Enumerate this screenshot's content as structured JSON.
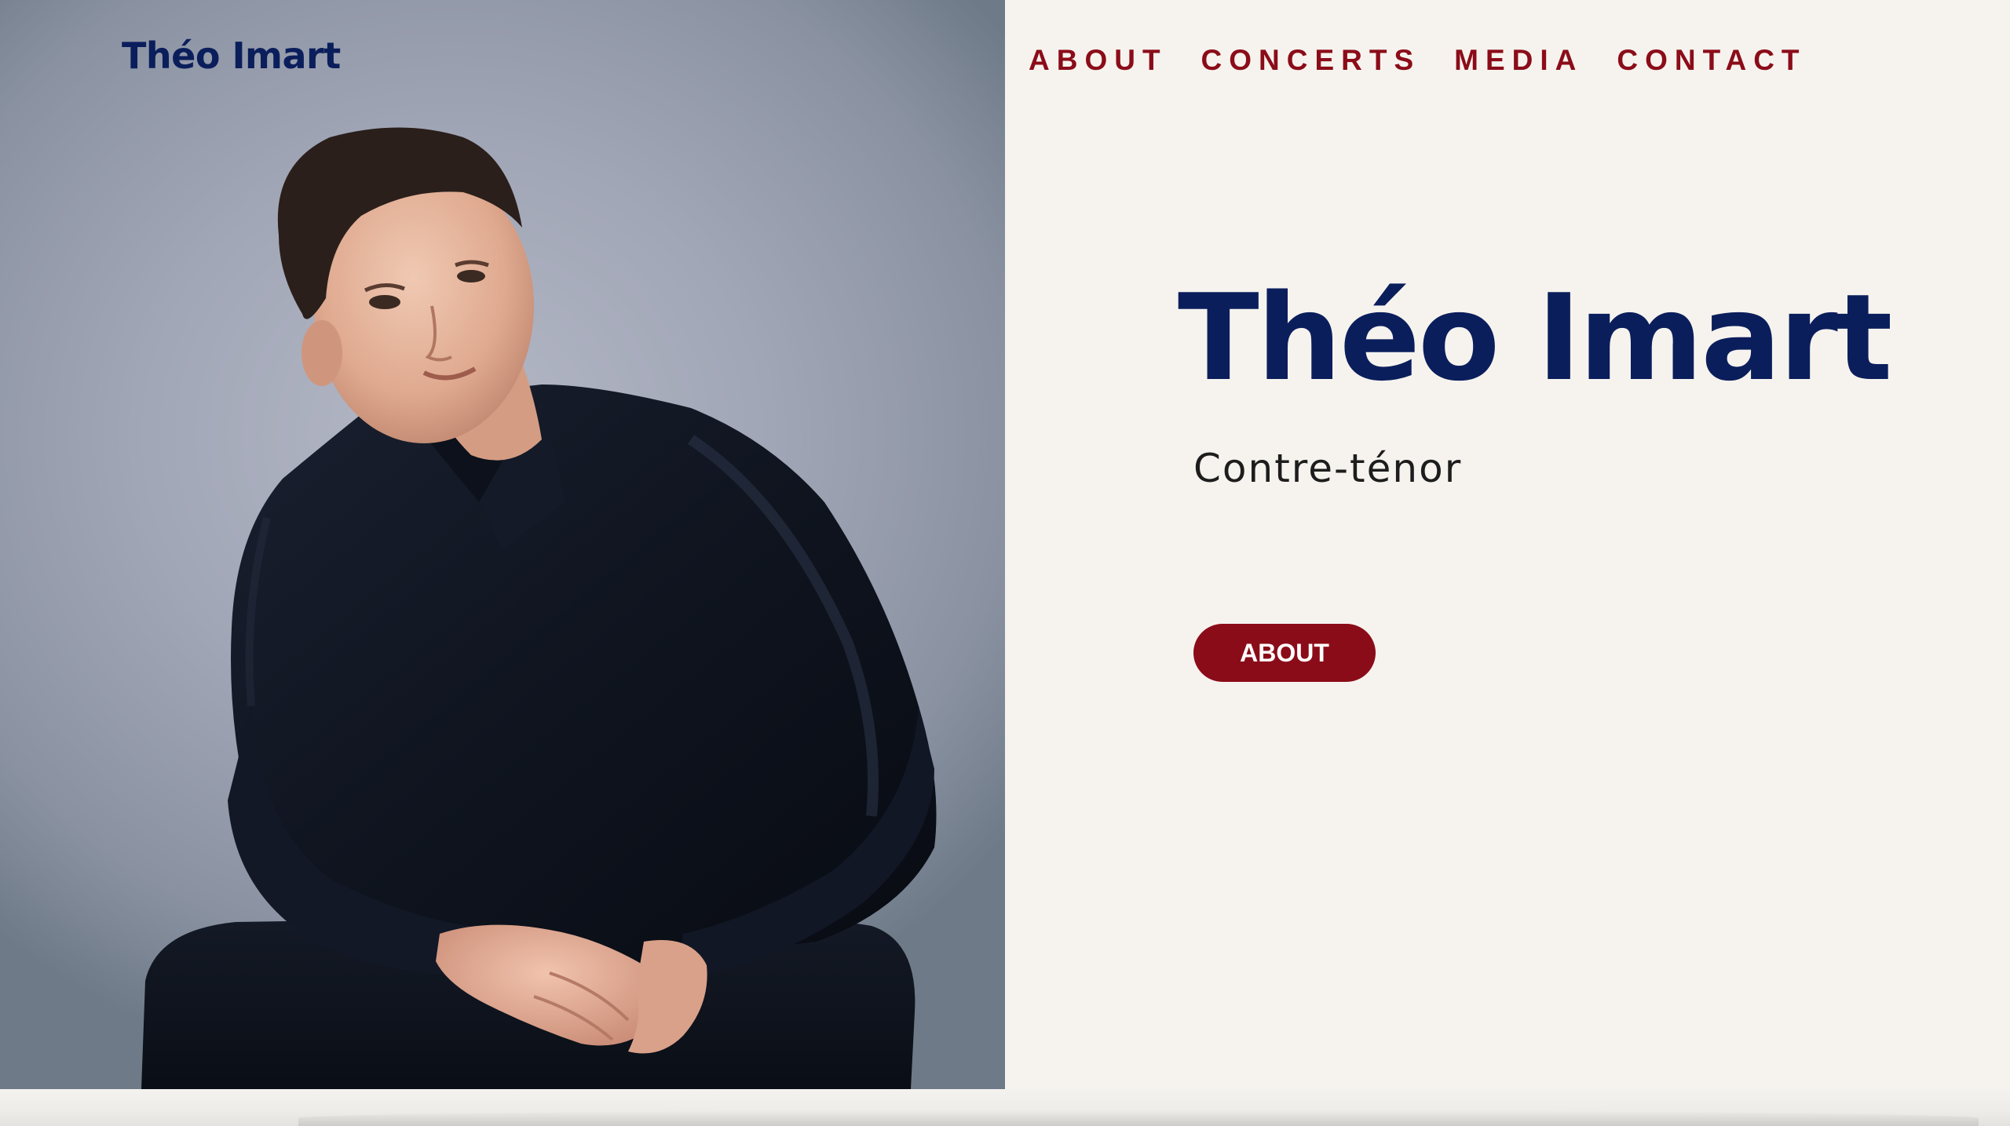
{
  "header": {
    "logo_text": "Théo Imart",
    "nav": [
      {
        "label": "ABOUT"
      },
      {
        "label": "CONCERTS"
      },
      {
        "label": "MEDIA"
      },
      {
        "label": "CONTACT"
      }
    ]
  },
  "hero": {
    "title": "Théo Imart",
    "subtitle": "Contre-ténor",
    "button_label": "ABOUT",
    "photo_icon": "portrait-photo"
  },
  "colors": {
    "navy": "#0b1e5c",
    "crimson": "#8b0c19",
    "background": "#f6f3ee"
  }
}
